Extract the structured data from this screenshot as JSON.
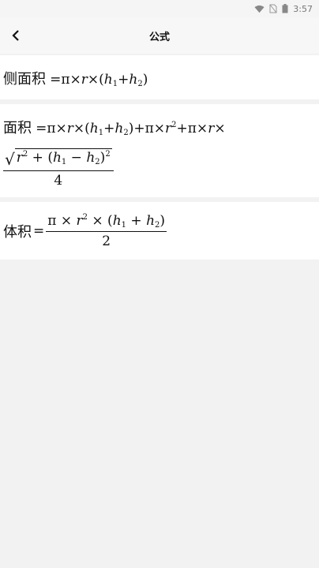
{
  "status_bar": {
    "time": "3:57"
  },
  "app_bar": {
    "title": "公式"
  },
  "formulas": [
    {
      "label": "侧面积"
    },
    {
      "label": "面积"
    },
    {
      "label": "体积"
    }
  ]
}
